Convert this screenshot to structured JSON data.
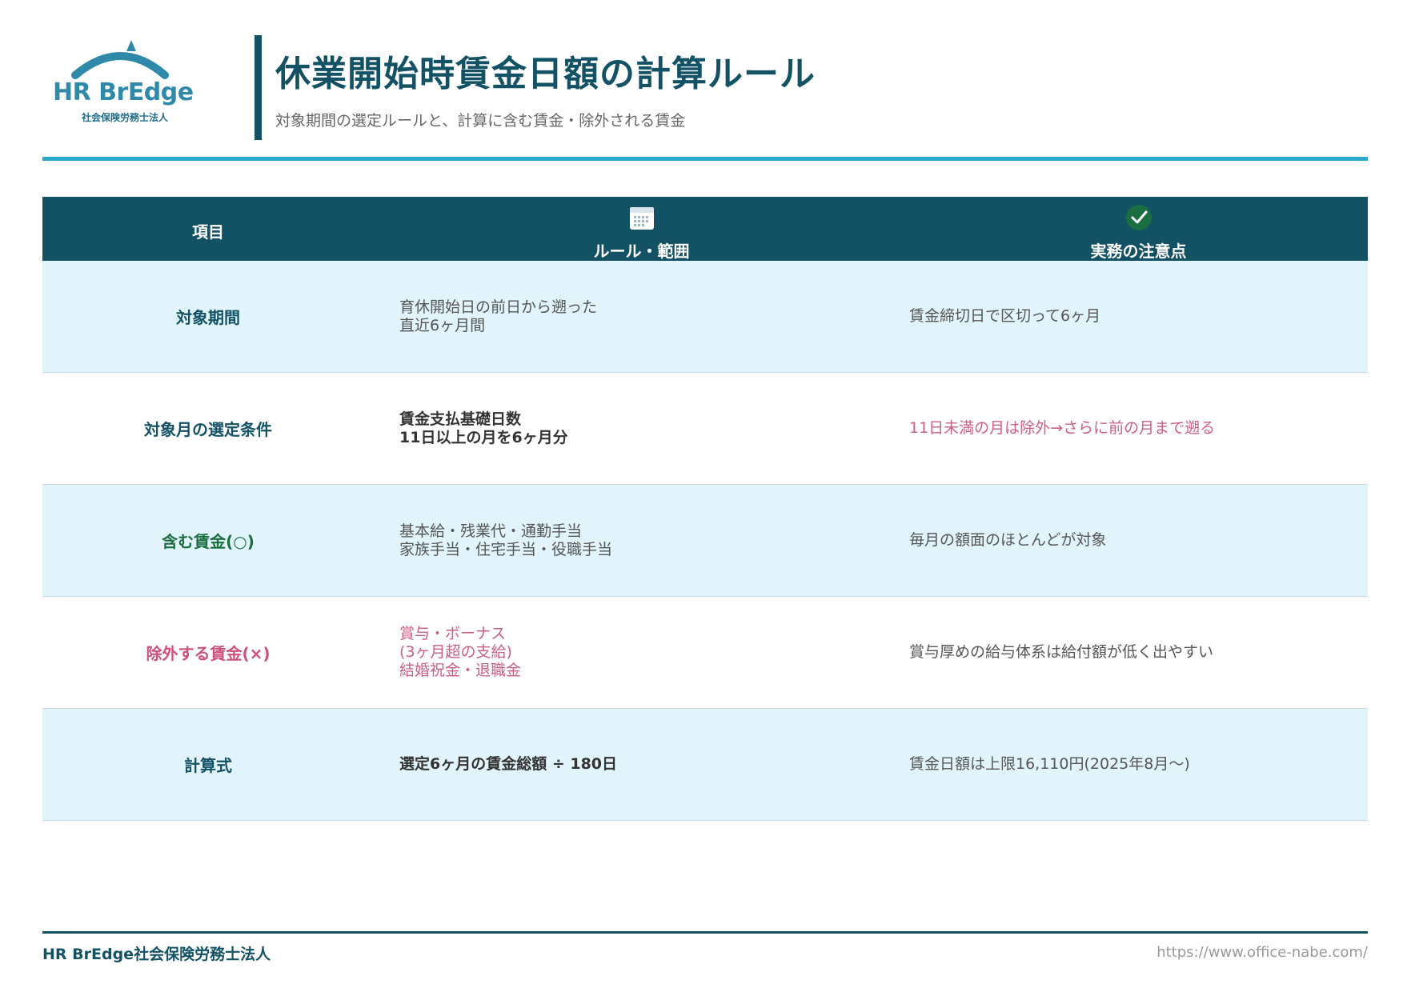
{
  "header": {
    "logo_text": "HR BrEdge",
    "logo_sub": "社会保険労務士法人",
    "title": "休業開始時賃金日額の計算ルール",
    "subtitle": "対象期間の選定ルールと、計算に含む賃金・除外される賃金"
  },
  "table": {
    "headers": {
      "item": "項目",
      "rule": "ルール・範囲",
      "note": "実務の注意点"
    },
    "icons": {
      "rule": "calendar-icon",
      "note": "check-circle-icon"
    },
    "rows": [
      {
        "item": "対象期間",
        "rule_lines": [
          "育休開始日の前日から遡った",
          "直近6ヶ月間"
        ],
        "note": "賃金締切日で区切って6ヶ月"
      },
      {
        "item": "対象月の選定条件",
        "rule_lines": [
          "賃金支払基礎日数",
          "11日以上の月を6ヶ月分"
        ],
        "note": "11日未満の月は除外→さらに前の月まで遡る"
      },
      {
        "item": "含む賃金(○)",
        "rule_lines": [
          "基本給・残業代・通勤手当",
          "家族手当・住宅手当・役職手当"
        ],
        "note": "毎月の額面のほとんどが対象"
      },
      {
        "item": "除外する賃金(×)",
        "rule_lines": [
          "賞与・ボーナス",
          "(3ヶ月超の支給)",
          "結婚祝金・退職金"
        ],
        "note": "賞与厚めの給与体系は給付額が低く出やすい"
      },
      {
        "item": "計算式",
        "rule_lines": [
          "選定6ヶ月の賃金総額 ÷ 180日"
        ],
        "note": "賃金日額は上限16,110円(2025年8月〜)"
      }
    ]
  },
  "footer": {
    "company": "HR BrEdge社会保険労務士法人",
    "url": "https://www.office-nabe.com/"
  },
  "colors": {
    "primary": "#135265",
    "accent": "#2aa8d0",
    "row_shade": "#e1f4fb",
    "green": "#1b6e3f",
    "pink": "#d0507a"
  }
}
